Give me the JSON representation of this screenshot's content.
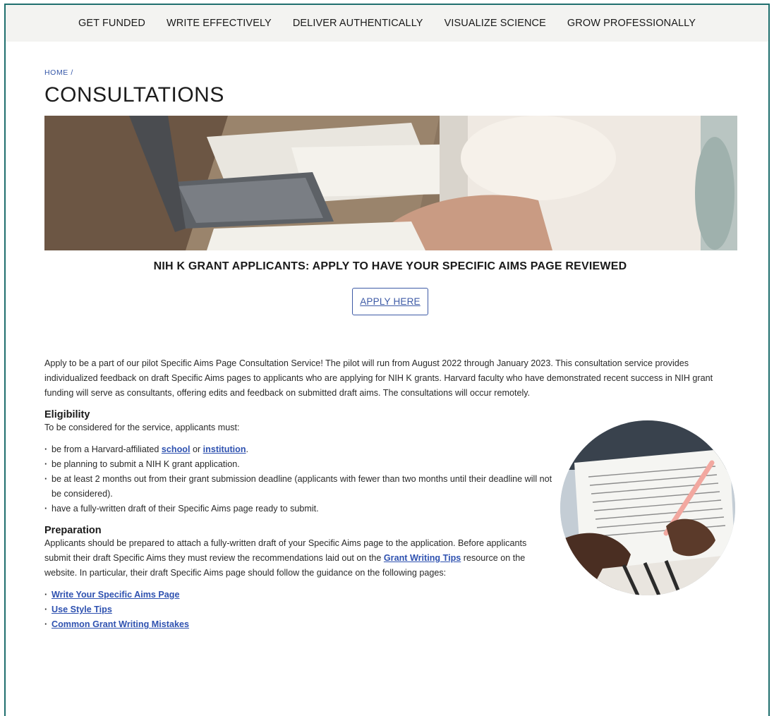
{
  "nav": {
    "items": [
      "GET FUNDED",
      "WRITE EFFECTIVELY",
      "DELIVER AUTHENTICALLY",
      "VISUALIZE SCIENCE",
      "GROW PROFESSIONALLY"
    ]
  },
  "breadcrumb": "HOME /",
  "page_title": "CONSULTATIONS",
  "subhead": "NIH K GRANT APPLICANTS: APPLY TO HAVE YOUR SPECIFIC AIMS PAGE REVIEWED",
  "cta_label": "APPLY HERE",
  "intro": "Apply to be a part of our pilot Specific Aims Page Consultation Service! The pilot will run from August 2022 through January 2023.  This consultation service provides individualized feedback on draft Specific Aims pages to applicants who are applying for NIH K grants. Harvard faculty who have demonstrated recent success in NIH grant funding will serve as consultants, offering edits and feedback on submitted draft aims. The consultations will occur remotely.",
  "eligibility": {
    "title": "Eligibility",
    "lead": "To be considered for the service, applicants must:",
    "b1_pre": "be from a Harvard-affiliated ",
    "b1_link1": "school",
    "b1_mid": " or ",
    "b1_link2": "institution",
    "b1_post": ".",
    "b2": "be planning to submit a NIH K grant application.",
    "b3": "be at least 2 months out from their grant submission deadline (applicants with fewer than two months until their deadline will not be considered).",
    "b4": "have a fully-written draft of their Specific Aims page ready to submit."
  },
  "preparation": {
    "title": "Preparation",
    "p_pre": "Applicants should be prepared to attach a fully-written draft of your Specific Aims page to the application. Before applicants submit their draft Specific Aims they must review the recommendations laid out on the ",
    "p_link": "Grant Writing Tips",
    "p_post": " resource on the website. In particular, their draft Specific Aims page should follow the guidance on the following  pages:",
    "links": [
      "Write Your Specific Aims Page",
      "Use Style Tips",
      "Common Grant Writing Mistakes"
    ]
  },
  "colors": {
    "accent": "#2f52b0",
    "frame": "#1f6f6e",
    "nav_bg": "#f3f3f1"
  }
}
